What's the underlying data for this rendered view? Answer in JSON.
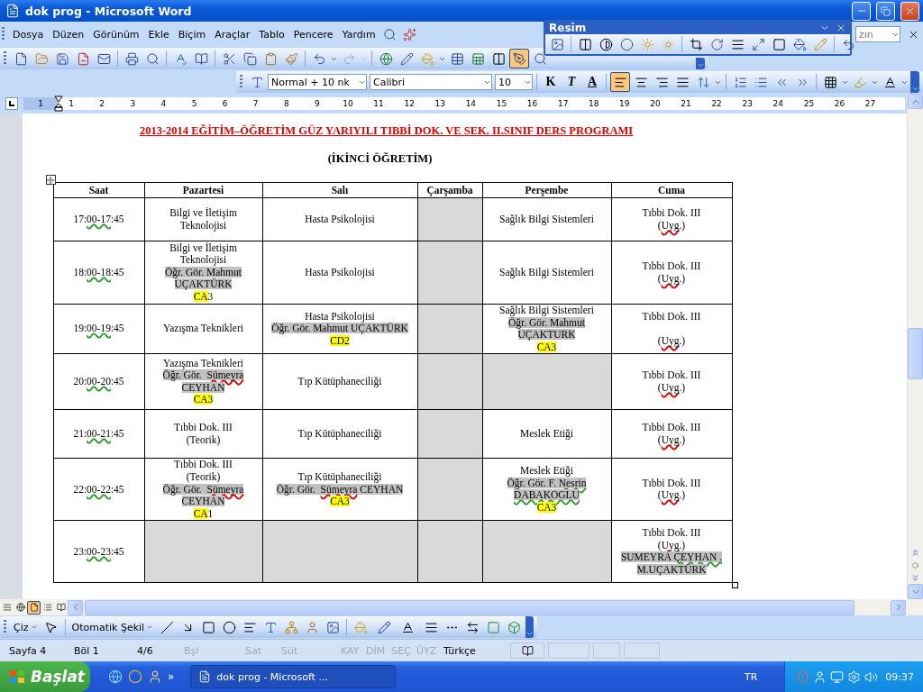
{
  "window": {
    "title": "dok prog - Microsoft Word"
  },
  "menu": [
    "Dosya",
    "Düzen",
    "Görünüm",
    "Ekle",
    "Biçim",
    "Araçlar",
    "Tablo",
    "Pencere",
    "Yardım"
  ],
  "help_field": {
    "value": "zın"
  },
  "picture_toolbar": {
    "title": "Resim"
  },
  "standard_toolbar": {
    "drawing_toggle": {
      "selected": true
    }
  },
  "formatting_toolbar": {
    "style": "Normal + 10 nk",
    "font": "Calibri",
    "size": "10",
    "buttons": [
      "K",
      "T",
      "A"
    ],
    "alignment": [
      {
        "kind": "left",
        "selected": true
      },
      {
        "kind": "center",
        "selected": false
      },
      {
        "kind": "right",
        "selected": false
      },
      {
        "kind": "justify",
        "selected": false
      }
    ]
  },
  "ruler": {
    "labels": [
      "1",
      "1",
      "2",
      "3",
      "4",
      "5",
      "6",
      "7",
      "8",
      "9",
      "10",
      "11",
      "12",
      "13",
      "14",
      "15",
      "16",
      "17",
      "18",
      "19",
      "20",
      "21",
      "22",
      "23",
      "24",
      "25",
      "26",
      "27"
    ]
  },
  "document": {
    "heading": "2013-2014 EĞİTİM–ÖĞRETİM GÜZ YARIYILI TIBBİ DOK. VE SEK. II.SINIF DERS PROGRAMI",
    "subheading": "(İKİNCİ ÖĞRETİM)",
    "table": {
      "columns": [
        "Saat",
        "Pazartesi",
        "Salı",
        "Çarşamba",
        "Perşembe",
        "Cuma"
      ],
      "rows": [
        {
          "cells": [
            {
              "shaded": false,
              "lines": [
                {
                  "runs": [
                    {
                      "text": "17:"
                    },
                    {
                      "text": "00-17",
                      "grammar_error": true
                    },
                    {
                      "text": ":45"
                    }
                  ]
                }
              ]
            },
            {
              "shaded": false,
              "lines": [
                {
                  "runs": [
                    {
                      "text": "Bilgi ve İletişim"
                    }
                  ]
                },
                {
                  "runs": [
                    {
                      "text": "Teknolojisi"
                    }
                  ]
                }
              ]
            },
            {
              "shaded": false,
              "lines": [
                {
                  "runs": [
                    {
                      "text": "Hasta Psikolojisi"
                    }
                  ]
                }
              ]
            },
            {
              "shaded": true
            },
            {
              "shaded": false,
              "lines": [
                {
                  "runs": [
                    {
                      "text": "Sağlık Bilgi Sistemleri"
                    }
                  ]
                }
              ]
            },
            {
              "shaded": false,
              "lines": [
                {
                  "runs": [
                    {
                      "text": "Tıbbi Dok. III"
                    }
                  ]
                },
                {
                  "runs": [
                    {
                      "text": "("
                    },
                    {
                      "text": "Uyg",
                      "spelling_error": true
                    },
                    {
                      "text": ".)"
                    }
                  ]
                }
              ]
            }
          ]
        },
        {
          "cells": [
            {
              "shaded": false,
              "lines": [
                {
                  "runs": [
                    {
                      "text": "18:"
                    },
                    {
                      "text": "00-18",
                      "grammar_error": true
                    },
                    {
                      "text": ":45"
                    }
                  ]
                }
              ]
            },
            {
              "shaded": false,
              "lines": [
                {
                  "runs": [
                    {
                      "text": "Bilgi ve İletişim"
                    }
                  ]
                },
                {
                  "runs": [
                    {
                      "text": "Teknolojisi"
                    }
                  ]
                },
                {
                  "runs": [
                    {
                      "text": "Öğr. Gör. Mahmut",
                      "gray_highlight": true
                    }
                  ]
                },
                {
                  "runs": [
                    {
                      "text": "UÇAKTÜRK",
                      "gray_highlight": true
                    }
                  ]
                },
                {
                  "runs": [
                    {
                      "text": "CA",
                      "yellow_highlight": true
                    },
                    {
                      "text": "3"
                    }
                  ]
                }
              ]
            },
            {
              "shaded": false,
              "lines": [
                {
                  "runs": [
                    {
                      "text": "Hasta Psikolojisi"
                    }
                  ]
                }
              ]
            },
            {
              "shaded": true
            },
            {
              "shaded": false,
              "lines": [
                {
                  "runs": [
                    {
                      "text": "Sağlık Bilgi Sistemleri"
                    }
                  ]
                }
              ]
            },
            {
              "shaded": false,
              "lines": [
                {
                  "runs": [
                    {
                      "text": "Tıbbi Dok. III"
                    }
                  ]
                },
                {
                  "runs": [
                    {
                      "text": "("
                    },
                    {
                      "text": "Uyg",
                      "spelling_error": true
                    },
                    {
                      "text": ".)"
                    }
                  ]
                }
              ]
            }
          ]
        },
        {
          "cells": [
            {
              "shaded": false,
              "lines": [
                {
                  "runs": [
                    {
                      "text": "19:"
                    },
                    {
                      "text": "00-19",
                      "grammar_error": true
                    },
                    {
                      "text": ":45"
                    }
                  ]
                }
              ]
            },
            {
              "shaded": false,
              "lines": [
                {
                  "runs": [
                    {
                      "text": "Yazışma Teknikleri"
                    }
                  ]
                }
              ]
            },
            {
              "shaded": false,
              "lines": [
                {
                  "runs": [
                    {
                      "text": "Hasta Psikolojisi"
                    }
                  ]
                },
                {
                  "runs": [
                    {
                      "text": "Öğr. Gör. Mahmut UÇAKTÜRK",
                      "gray_highlight": true
                    }
                  ]
                },
                {
                  "runs": [
                    {
                      "text": "CD2",
                      "yellow_highlight": true
                    }
                  ]
                }
              ]
            },
            {
              "shaded": true
            },
            {
              "shaded": false,
              "lines": [
                {
                  "runs": [
                    {
                      "text": "Sağlık Bilgi Sistemleri"
                    }
                  ]
                },
                {
                  "runs": [
                    {
                      "text": "Öğr. Gör. Mahmut",
                      "gray_highlight": true
                    }
                  ]
                },
                {
                  "runs": [
                    {
                      "text": "UÇAKTURK",
                      "gray_highlight": true
                    }
                  ]
                },
                {
                  "runs": [
                    {
                      "text": "CA3",
                      "yellow_highlight": true
                    }
                  ]
                }
              ]
            },
            {
              "shaded": false,
              "lines": [
                {
                  "runs": [
                    {
                      "text": "Tıbbi Dok. III"
                    }
                  ]
                },
                {
                  "gap_before": true,
                  "runs": [
                    {
                      "text": "("
                    },
                    {
                      "text": "Uyg",
                      "spelling_error": true
                    },
                    {
                      "text": ".)"
                    }
                  ]
                }
              ]
            }
          ]
        },
        {
          "cells": [
            {
              "shaded": false,
              "lines": [
                {
                  "runs": [
                    {
                      "text": "20:"
                    },
                    {
                      "text": "00-20",
                      "grammar_error": true
                    },
                    {
                      "text": ":45"
                    }
                  ]
                }
              ]
            },
            {
              "shaded": false,
              "lines": [
                {
                  "runs": [
                    {
                      "text": "Yazışma Teknikleri"
                    }
                  ]
                },
                {
                  "runs": [
                    {
                      "text": "Öğr. Gör.  ",
                      "gray_highlight": true
                    },
                    {
                      "text": "Sümeyra",
                      "gray_highlight": true,
                      "spelling_error": true
                    }
                  ]
                },
                {
                  "runs": [
                    {
                      "text": "CEYHAN",
                      "gray_highlight": true
                    }
                  ]
                },
                {
                  "runs": [
                    {
                      "text": "CA3",
                      "yellow_highlight": true
                    }
                  ]
                }
              ]
            },
            {
              "shaded": false,
              "lines": [
                {
                  "runs": [
                    {
                      "text": "Tıp Kütüphaneciliği"
                    }
                  ]
                }
              ]
            },
            {
              "shaded": true
            },
            {
              "shaded": true
            },
            {
              "shaded": false,
              "lines": [
                {
                  "runs": [
                    {
                      "text": "Tıbbi Dok. III"
                    }
                  ]
                },
                {
                  "runs": [
                    {
                      "text": "("
                    },
                    {
                      "text": "Uyg",
                      "spelling_error": true
                    },
                    {
                      "text": ".)"
                    }
                  ]
                }
              ]
            }
          ]
        },
        {
          "cells": [
            {
              "shaded": false,
              "lines": [
                {
                  "runs": [
                    {
                      "text": "21:"
                    },
                    {
                      "text": "00-21",
                      "grammar_error": true
                    },
                    {
                      "text": ":45"
                    }
                  ]
                }
              ]
            },
            {
              "shaded": false,
              "lines": [
                {
                  "runs": [
                    {
                      "text": "Tıbbi Dok. III"
                    }
                  ]
                },
                {
                  "runs": [
                    {
                      "text": "(Teorik)"
                    }
                  ]
                }
              ]
            },
            {
              "shaded": false,
              "lines": [
                {
                  "runs": [
                    {
                      "text": "Tıp Kütüphaneciliği"
                    }
                  ]
                }
              ]
            },
            {
              "shaded": true
            },
            {
              "shaded": false,
              "lines": [
                {
                  "runs": [
                    {
                      "text": "Meslek Etiği"
                    }
                  ]
                }
              ]
            },
            {
              "shaded": false,
              "lines": [
                {
                  "runs": [
                    {
                      "text": "Tıbbi Dok. III"
                    }
                  ]
                },
                {
                  "runs": [
                    {
                      "text": "("
                    },
                    {
                      "text": "Uyg",
                      "spelling_error": true
                    },
                    {
                      "text": ".)"
                    }
                  ]
                }
              ]
            }
          ]
        },
        {
          "cells": [
            {
              "shaded": false,
              "lines": [
                {
                  "runs": [
                    {
                      "text": "22:"
                    },
                    {
                      "text": "00-22",
                      "grammar_error": true
                    },
                    {
                      "text": ":45"
                    }
                  ]
                }
              ]
            },
            {
              "shaded": false,
              "lines": [
                {
                  "runs": [
                    {
                      "text": "Tıbbi Dok. III"
                    }
                  ]
                },
                {
                  "runs": [
                    {
                      "text": "(Teorik)"
                    }
                  ]
                },
                {
                  "runs": [
                    {
                      "text": "Öğr. Gör.  ",
                      "gray_highlight": true
                    },
                    {
                      "text": "Sümeyra",
                      "gray_highlight": true,
                      "spelling_error": true
                    }
                  ]
                },
                {
                  "runs": [
                    {
                      "text": "CEYHAN",
                      "gray_highlight": true
                    }
                  ]
                },
                {
                  "runs": [
                    {
                      "text": "CA",
                      "yellow_highlight": true
                    },
                    {
                      "text": "1"
                    }
                  ]
                }
              ]
            },
            {
              "shaded": false,
              "lines": [
                {
                  "runs": [
                    {
                      "text": "Tıp Kütüphaneciliği"
                    }
                  ]
                },
                {
                  "runs": [
                    {
                      "text": "Öğr. Gör.  ",
                      "gray_highlight": true
                    },
                    {
                      "text": "Sümeyra",
                      "gray_highlight": true,
                      "spelling_error": true
                    },
                    {
                      "text": " CEYHAN",
                      "gray_highlight": true
                    }
                  ]
                },
                {
                  "runs": [
                    {
                      "text": "CA3",
                      "yellow_highlight": true
                    }
                  ]
                }
              ]
            },
            {
              "shaded": true
            },
            {
              "shaded": false,
              "lines": [
                {
                  "runs": [
                    {
                      "text": "Meslek Etiği"
                    }
                  ]
                },
                {
                  "runs": [
                    {
                      "text": "Öğr. Gör. F. ",
                      "gray_highlight": true
                    },
                    {
                      "text": "Nesrin",
                      "gray_highlight": true,
                      "grammar_error": true
                    }
                  ]
                },
                {
                  "runs": [
                    {
                      "text": "DABAKOGLU",
                      "gray_highlight": true,
                      "grammar_error": true
                    }
                  ]
                },
                {
                  "runs": [
                    {
                      "text": "CA3",
                      "yellow_highlight": true
                    }
                  ]
                }
              ]
            },
            {
              "shaded": false,
              "lines": [
                {
                  "runs": [
                    {
                      "text": "Tıbbi Dok. III"
                    }
                  ]
                },
                {
                  "runs": [
                    {
                      "text": "("
                    },
                    {
                      "text": "Uyg",
                      "spelling_error": true
                    },
                    {
                      "text": ".)"
                    }
                  ]
                }
              ]
            }
          ]
        },
        {
          "cells": [
            {
              "shaded": false,
              "lines": [
                {
                  "runs": [
                    {
                      "text": "23:"
                    },
                    {
                      "text": "00-23",
                      "grammar_error": true
                    },
                    {
                      "text": ":45"
                    }
                  ]
                }
              ]
            },
            {
              "shaded": true
            },
            {
              "shaded": true
            },
            {
              "shaded": true
            },
            {
              "shaded": true
            },
            {
              "shaded": false,
              "lines": [
                {
                  "runs": [
                    {
                      "text": "Tıbbi Dok. III"
                    }
                  ]
                },
                {
                  "runs": [
                    {
                      "text": "("
                    },
                    {
                      "text": "Uyg",
                      "spelling_error": true
                    },
                    {
                      "text": ".)"
                    }
                  ]
                },
                {
                  "runs": [
                    {
                      "text": "SUMEYRA ",
                      "gray_highlight": true
                    },
                    {
                      "text": "ÇEYHAN .",
                      "gray_highlight": true,
                      "grammar_error": true
                    }
                  ]
                },
                {
                  "runs": [
                    {
                      "text": "M.UÇAKTÜRK",
                      "gray_highlight": true
                    }
                  ]
                }
              ]
            }
          ]
        }
      ]
    }
  },
  "view_buttons": [
    {
      "kind": "normal",
      "selected": false
    },
    {
      "kind": "web",
      "selected": false
    },
    {
      "kind": "print",
      "selected": true
    },
    {
      "kind": "outline",
      "selected": false
    },
    {
      "kind": "reading",
      "selected": false
    }
  ],
  "drawing_toolbar": {
    "draw": "Çiz",
    "autoshapes": "Otomatik Şekil"
  },
  "status_bar": [
    {
      "text": "Sayfa 4",
      "disabled": false
    },
    {
      "text": "Böl 1",
      "disabled": false
    },
    {
      "text": "4/6",
      "disabled": false
    },
    {
      "text": "Bşl",
      "disabled": true
    },
    {
      "text": "Sat",
      "disabled": true
    },
    {
      "text": "Süt",
      "disabled": true
    },
    {
      "text": "KAY",
      "disabled": true
    },
    {
      "text": "DİM",
      "disabled": true
    },
    {
      "text": "SEÇ",
      "disabled": true
    },
    {
      "text": "ÜYZ",
      "disabled": true
    },
    {
      "text": "Türkçe",
      "disabled": false
    }
  ],
  "taskbar": {
    "start": "Başlat",
    "more": "»",
    "task": "dok prog - Microsoft ...",
    "language": "TR",
    "clock": "09:37"
  }
}
